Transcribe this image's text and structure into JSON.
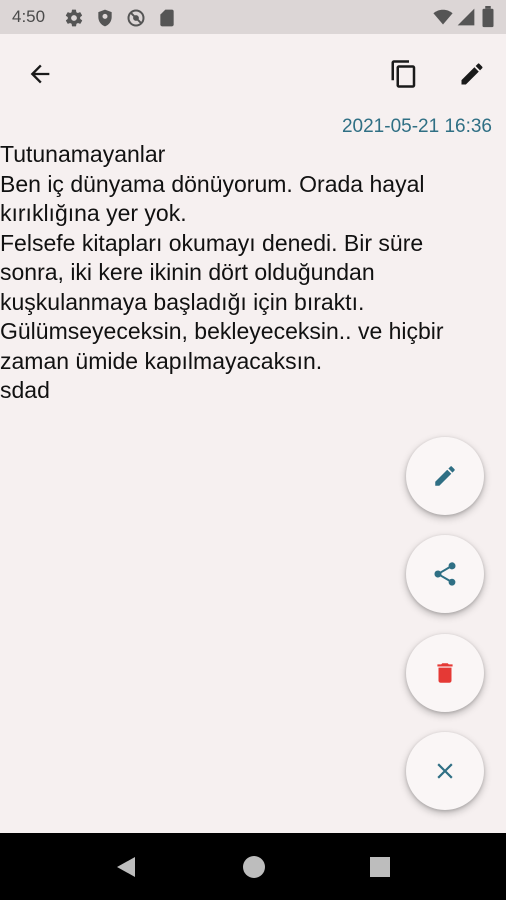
{
  "status_bar": {
    "time": "4:50",
    "left_icons": [
      "settings-gear-icon",
      "shield-icon",
      "no-sync-icon",
      "sd-card-icon"
    ],
    "right_icons": [
      "wifi-icon",
      "cellular-signal-icon",
      "battery-icon"
    ]
  },
  "app_bar": {
    "back_icon": "arrow-back-icon",
    "actions": [
      "copy-icon",
      "edit-pencil-icon"
    ]
  },
  "note": {
    "timestamp": "2021-05-21 16:36",
    "lines": [
      "Tutunamayanlar",
      "Ben iç dünyama dönüyorum. Orada hayal",
      "kırıklığına yer yok.",
      "Felsefe kitapları okumayı denedi. Bir süre",
      "sonra, iki kere ikinin dört olduğundan",
      "kuşkulanmaya başladığı için bıraktı.",
      "Gülümseyeceksin, bekleyeceksin.. ve hiçbir",
      "zaman ümide kapılmayacaksın.",
      "sdad"
    ]
  },
  "fab_menu": {
    "buttons": [
      "edit-icon",
      "share-icon",
      "delete-icon",
      "close-icon"
    ],
    "colors": {
      "accent": "#2f6f84",
      "delete": "#e53935"
    }
  },
  "nav_bar": {
    "buttons": [
      "back-triangle-icon",
      "home-circle-icon",
      "recents-square-icon"
    ]
  }
}
